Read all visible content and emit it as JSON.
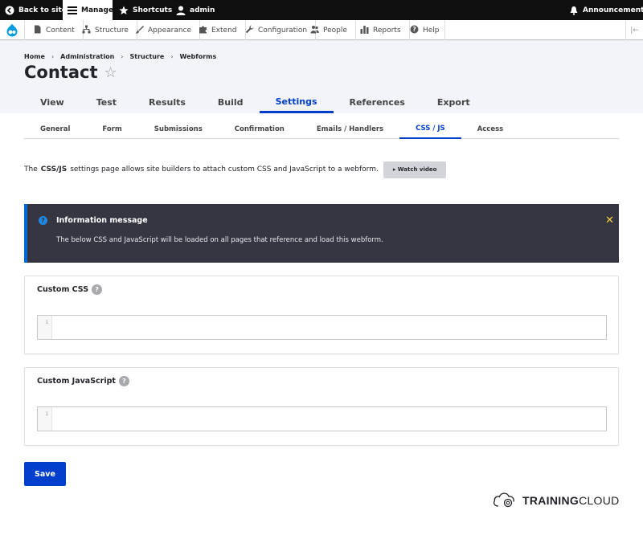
{
  "toolbar": {
    "back_to_site": "Back to site",
    "manage": "Manage",
    "shortcuts": "Shortcuts",
    "user": "admin",
    "announcements": "Announcements"
  },
  "tray": {
    "items": [
      "Content",
      "Structure",
      "Appearance",
      "Extend",
      "Configuration",
      "People",
      "Reports",
      "Help"
    ],
    "toggle_glyph": "|←"
  },
  "breadcrumb": [
    "Home",
    "Administration",
    "Structure",
    "Webforms"
  ],
  "breadcrumb_separator": "›",
  "page_title": "Contact",
  "star_glyph": "☆",
  "primary_tabs": [
    "View",
    "Test",
    "Results",
    "Build",
    "Settings",
    "References",
    "Export"
  ],
  "primary_active": "Settings",
  "secondary_tabs": [
    "General",
    "Form",
    "Submissions",
    "Confirmation",
    "Emails / Handlers",
    "CSS / JS",
    "Access"
  ],
  "secondary_active": "CSS / JS",
  "intro": {
    "before": "The",
    "bold": "CSS/JS",
    "after": "settings page allows site builders to attach custom CSS and JavaScript to a webform.",
    "watch_video": "▸ Watch video"
  },
  "message": {
    "icon_glyph": "?",
    "title": "Information message",
    "text": "The below CSS and JavaScript will be loaded on all pages that reference and load this webform.",
    "close_glyph": "✕"
  },
  "custom_css": {
    "label": "Custom CSS",
    "help_glyph": "?",
    "line_number": "1"
  },
  "custom_js": {
    "label": "Custom JavaScript",
    "help_glyph": "?",
    "line_number": "1"
  },
  "save_label": "Save",
  "brand": {
    "bold": "TRAINING",
    "rest": "CLOUD"
  },
  "colors": {
    "toolbar_bg": "#0f0f0f",
    "accent": "#003ecc",
    "message_bg": "#353641",
    "message_close": "#ffd23f"
  }
}
